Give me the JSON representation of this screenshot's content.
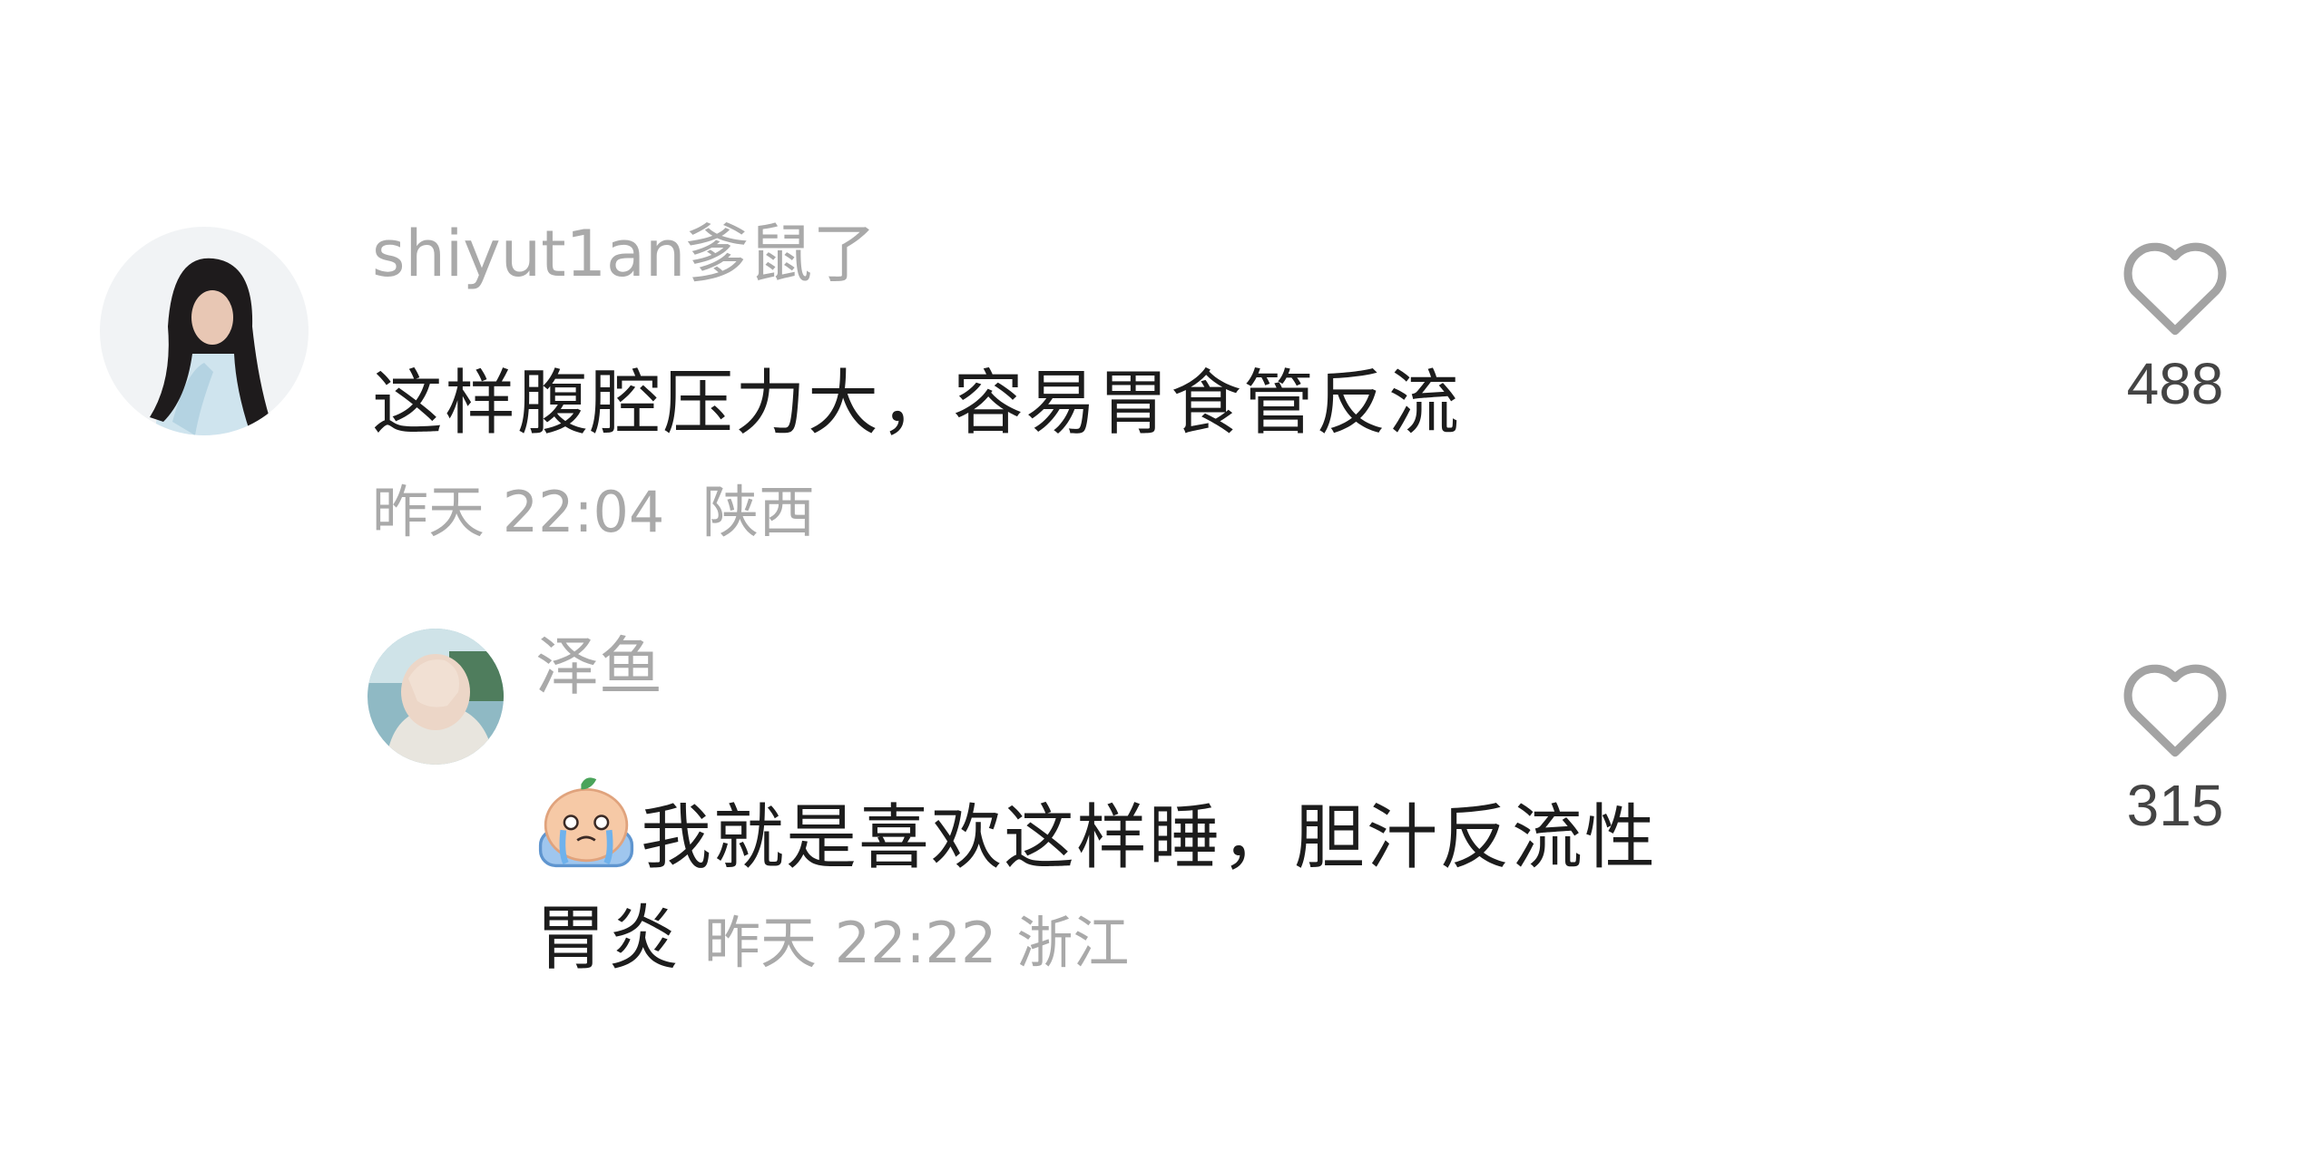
{
  "comments": [
    {
      "username": "shiyut1an爹鼠了",
      "text": "这样腹腔压力大，容易胃食管反流",
      "time": "昨天 22:04",
      "location": "陕西",
      "likes": "488",
      "avatar_icon": "user-avatar-girl-dark-hair"
    },
    {
      "username": "泽鱼",
      "emoji_icon": "crying-face-emoji",
      "text_line1": "我就是喜欢这样睡，胆汁反流性",
      "text_line2": "胃炎",
      "time": "昨天 22:22",
      "location": "浙江",
      "likes": "315",
      "avatar_icon": "user-avatar-covering-face"
    }
  ],
  "colors": {
    "primary_text": "#1c1c1c",
    "secondary_text": "#a9a9a9",
    "like_icon": "#a3a3a3"
  }
}
